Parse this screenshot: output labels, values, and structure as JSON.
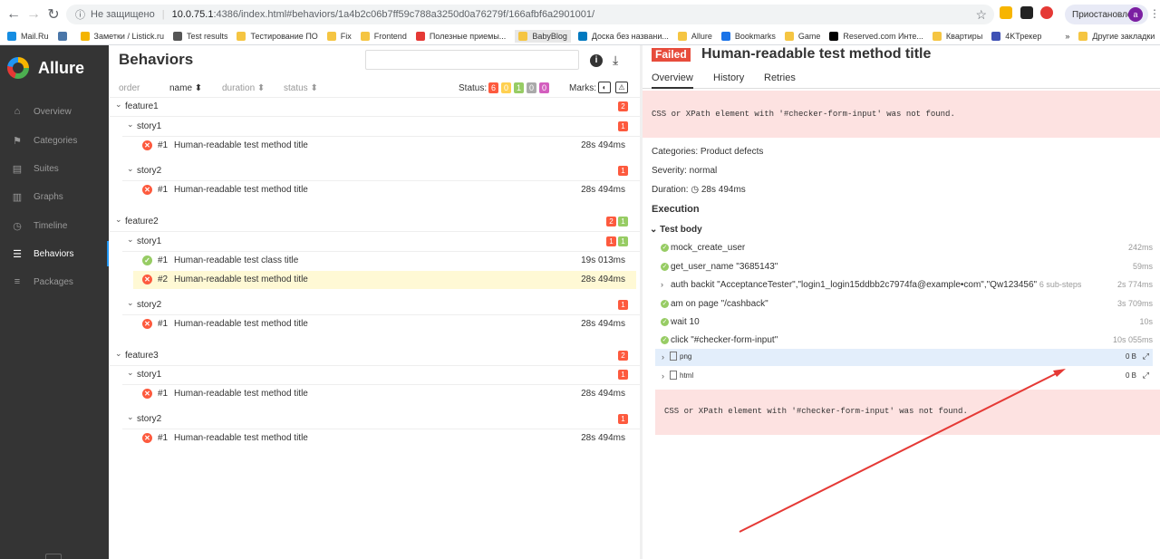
{
  "browser": {
    "insecure_label": "Не защищено",
    "url_host": "10.0.75.1",
    "url_path": ":4386/index.html#behaviors/1a4b2c06b7ff59c788a3250d0a76279f/166afbf6a2901001/",
    "profile_label": "Приостановлена",
    "profile_initial": "a"
  },
  "bookmarks": [
    {
      "label": "Mail.Ru",
      "color": "#168de2"
    },
    {
      "label": "",
      "color": "#4a76a8"
    },
    {
      "label": "Заметки / Listick.ru",
      "color": "#f4b400"
    },
    {
      "label": "Test results",
      "color": "#555555"
    },
    {
      "label": "Тестирование ПО",
      "color": "#f5c542"
    },
    {
      "label": "Fix",
      "color": "#f5c542"
    },
    {
      "label": "Frontend",
      "color": "#f5c542"
    },
    {
      "label": "Полезные приемы...",
      "color": "#e53935"
    },
    {
      "label": "BabyBlog",
      "color": "#f5c542"
    },
    {
      "label": "Доска без названи...",
      "color": "#0079bf"
    },
    {
      "label": "Allure",
      "color": "#f5c542"
    },
    {
      "label": "Bookmarks",
      "color": "#1a73e8"
    },
    {
      "label": "Game",
      "color": "#f5c542"
    },
    {
      "label": "Reserved.com Инте...",
      "color": "#000000"
    },
    {
      "label": "Квартиры",
      "color": "#f5c542"
    },
    {
      "label": "4KТрекер",
      "color": "#3f51b5"
    }
  ],
  "bookmarks_more": "»",
  "bookmarks_other": "Другие закладки",
  "sidebar": {
    "brand": "Allure",
    "items": [
      {
        "label": "Overview",
        "icon": "home-icon",
        "glyph": "⌂"
      },
      {
        "label": "Categories",
        "icon": "flag-icon",
        "glyph": "⚑"
      },
      {
        "label": "Suites",
        "icon": "briefcase-icon",
        "glyph": "▤"
      },
      {
        "label": "Graphs",
        "icon": "bar-chart-icon",
        "glyph": "▥"
      },
      {
        "label": "Timeline",
        "icon": "clock-icon",
        "glyph": "◷"
      },
      {
        "label": "Behaviors",
        "icon": "list-icon",
        "glyph": "☰"
      },
      {
        "label": "Packages",
        "icon": "stack-icon",
        "glyph": "≡"
      }
    ]
  },
  "behaviors": {
    "title": "Behaviors",
    "sort": {
      "order": "order",
      "name": "name",
      "duration": "duration",
      "status": "status"
    },
    "status_label": "Status:",
    "status_counts": [
      {
        "value": "6",
        "color": "#fd5a3e"
      },
      {
        "value": "0",
        "color": "#ffd050"
      },
      {
        "value": "1",
        "color": "#97cc64"
      },
      {
        "value": "0",
        "color": "#aaaaaa"
      },
      {
        "value": "0",
        "color": "#d35ebe"
      }
    ],
    "marks_label": "Marks:",
    "tree": [
      {
        "kind": "feature",
        "label": "feature1",
        "counts": [
          {
            "v": "2",
            "c": "#fd5a3e"
          }
        ]
      },
      {
        "kind": "story",
        "label": "story1",
        "counts": [
          {
            "v": "1",
            "c": "#fd5a3e"
          }
        ]
      },
      {
        "kind": "case",
        "status": "broken",
        "num": "#1",
        "title": "Human-readable test method title",
        "dur": "28s 494ms"
      },
      {
        "kind": "story",
        "label": "story2",
        "counts": [
          {
            "v": "1",
            "c": "#fd5a3e"
          }
        ]
      },
      {
        "kind": "case",
        "status": "broken",
        "num": "#1",
        "title": "Human-readable test method title",
        "dur": "28s 494ms"
      },
      {
        "kind": "feature",
        "label": "feature2",
        "counts": [
          {
            "v": "2",
            "c": "#fd5a3e"
          },
          {
            "v": "1",
            "c": "#97cc64"
          }
        ]
      },
      {
        "kind": "story",
        "label": "story1",
        "counts": [
          {
            "v": "1",
            "c": "#fd5a3e"
          },
          {
            "v": "1",
            "c": "#97cc64"
          }
        ]
      },
      {
        "kind": "case",
        "status": "passed",
        "num": "#1",
        "title": "Human-readable test class title",
        "dur": "19s 013ms"
      },
      {
        "kind": "case",
        "status": "broken",
        "num": "#2",
        "title": "Human-readable test method title",
        "dur": "28s 494ms",
        "selected": true
      },
      {
        "kind": "story",
        "label": "story2",
        "counts": [
          {
            "v": "1",
            "c": "#fd5a3e"
          }
        ]
      },
      {
        "kind": "case",
        "status": "broken",
        "num": "#1",
        "title": "Human-readable test method title",
        "dur": "28s 494ms"
      },
      {
        "kind": "feature",
        "label": "feature3",
        "counts": [
          {
            "v": "2",
            "c": "#fd5a3e"
          }
        ]
      },
      {
        "kind": "story",
        "label": "story1",
        "counts": [
          {
            "v": "1",
            "c": "#fd5a3e"
          }
        ]
      },
      {
        "kind": "case",
        "status": "broken",
        "num": "#1",
        "title": "Human-readable test method title",
        "dur": "28s 494ms"
      },
      {
        "kind": "story",
        "label": "story2",
        "counts": [
          {
            "v": "1",
            "c": "#fd5a3e"
          }
        ]
      },
      {
        "kind": "case",
        "status": "broken",
        "num": "#1",
        "title": "Human-readable test method title",
        "dur": "28s 494ms"
      }
    ]
  },
  "detail": {
    "status": "Failed",
    "title": "Human-readable test method title",
    "tabs": [
      "Overview",
      "History",
      "Retries"
    ],
    "error": "CSS or XPath element with '#checker-form-input' was not found.",
    "categories": "Categories: Product defects",
    "severity": "Severity: normal",
    "duration_label": "Duration:",
    "duration_value": "28s 494ms",
    "execution": "Execution",
    "test_body": "Test body",
    "steps": [
      {
        "name": "mock_create_user",
        "time": "242ms",
        "type": "ok"
      },
      {
        "name": "get_user_name \"3685143\"",
        "time": "59ms",
        "type": "ok"
      },
      {
        "name": "auth backit \"AcceptanceTester\",\"login1_login15ddbb2c7974fa@example•com\",\"Qw123456\"",
        "sub": "6 sub-steps",
        "time": "2s 774ms",
        "type": "group"
      },
      {
        "name": "am on page \"/cashback\"",
        "time": "3s 709ms",
        "type": "ok"
      },
      {
        "name": "wait 10",
        "time": "10s",
        "type": "ok"
      },
      {
        "name": "click \"#checker-form-input\"",
        "time": "10s 055ms",
        "type": "ok"
      }
    ],
    "attachments": [
      {
        "name": "png",
        "size": "0 B"
      },
      {
        "name": "html",
        "size": "0 B"
      }
    ]
  }
}
